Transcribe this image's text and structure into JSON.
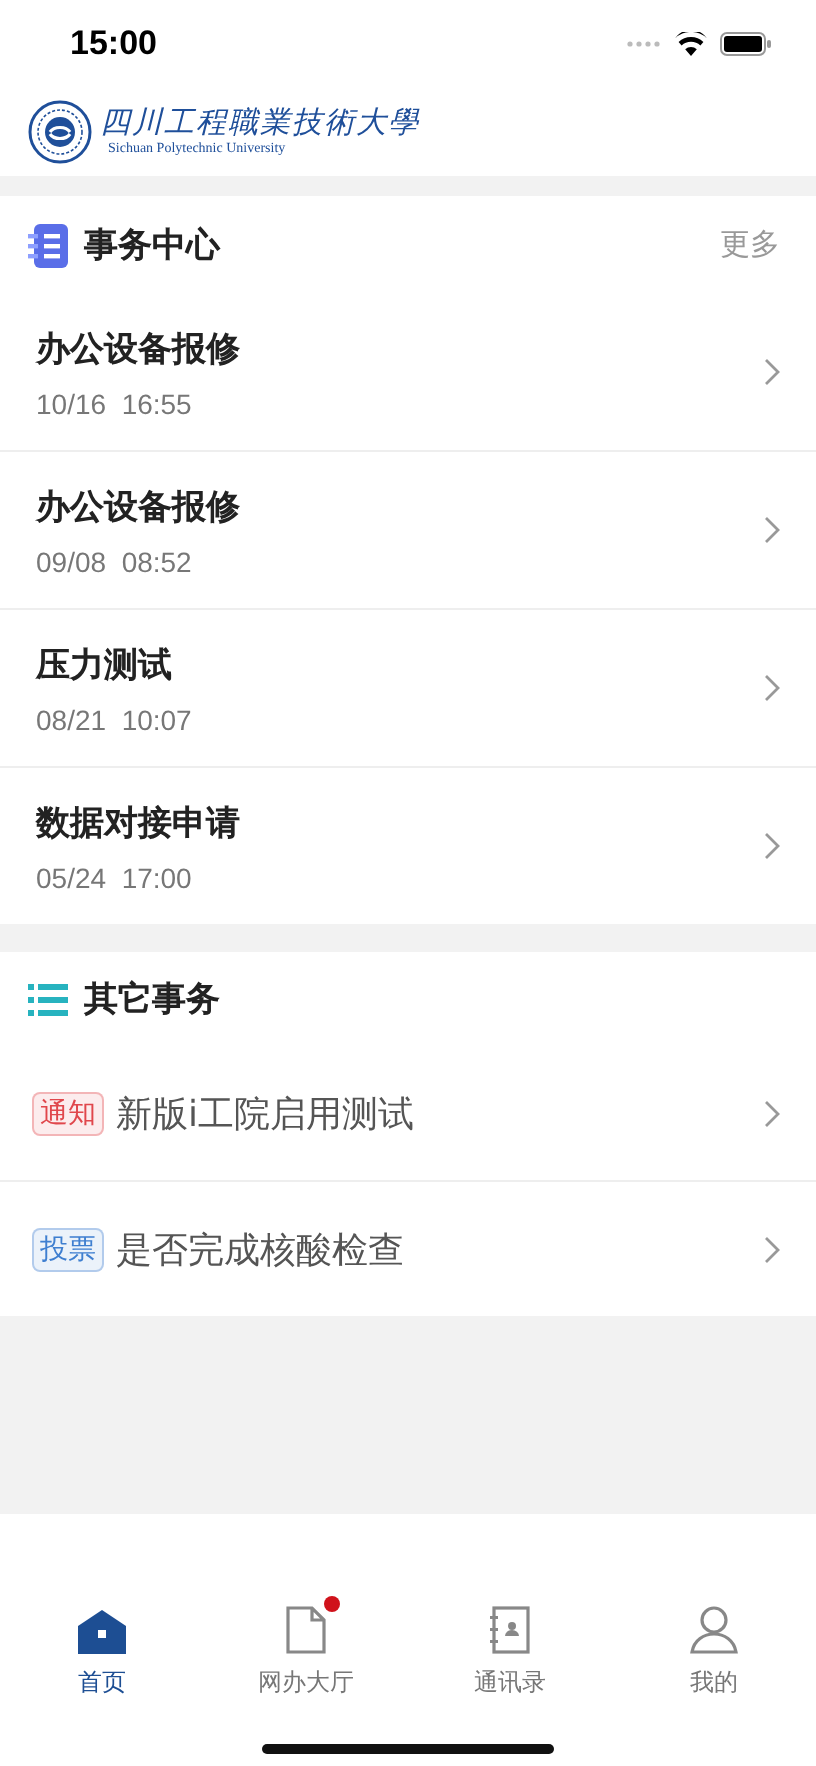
{
  "status_bar": {
    "time": "15:00"
  },
  "header": {
    "school_name": "四川工程職業技術大學",
    "school_name_en": "Sichuan  Polytechnic  University"
  },
  "task_center": {
    "title": "事务中心",
    "more": "更多",
    "items": [
      {
        "title": "办公设备报修",
        "date": "10/16",
        "time": "16:55"
      },
      {
        "title": "办公设备报修",
        "date": "09/08",
        "time": "08:52"
      },
      {
        "title": "压力测试",
        "date": "08/21",
        "time": "10:07"
      },
      {
        "title": "数据对接申请",
        "date": "05/24",
        "time": "17:00"
      }
    ]
  },
  "other_affairs": {
    "title": "其它事务",
    "items": [
      {
        "tag": "通知",
        "color": "#e0474c",
        "title": "新版i工院启用测试"
      },
      {
        "tag": "投票",
        "color": "#3f7fd0",
        "title": "是否完成核酸检查"
      }
    ]
  },
  "tab_bar": [
    {
      "label": "首页",
      "kind": "home",
      "selected": true,
      "badge": false
    },
    {
      "label": "网办大厅",
      "kind": "document",
      "selected": false,
      "badge": true
    },
    {
      "label": "通讯录",
      "kind": "contacts",
      "selected": false,
      "badge": false
    },
    {
      "label": "我的",
      "kind": "profile",
      "selected": false,
      "badge": false
    }
  ]
}
